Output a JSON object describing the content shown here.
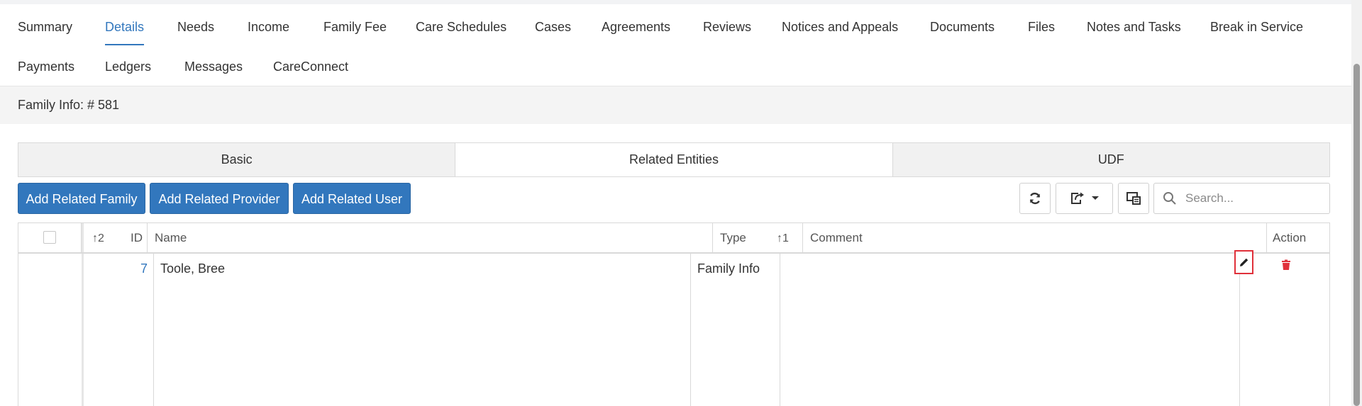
{
  "nav": {
    "row1": [
      "Summary",
      "Details",
      "Needs",
      "Income",
      "Family Fee",
      "Care Schedules",
      "Cases",
      "Agreements",
      "Reviews",
      "Notices and Appeals",
      "Documents",
      "Files",
      "Notes and Tasks",
      "Break in Service"
    ],
    "row2": [
      "Payments",
      "Ledgers",
      "Messages",
      "CareConnect"
    ],
    "active": "Details"
  },
  "header": {
    "title": "Family Info: # 581"
  },
  "subtabs": {
    "basic": "Basic",
    "related": "Related Entities",
    "udf": "UDF",
    "active": "Related Entities"
  },
  "toolbar": {
    "add_family": "Add Related Family",
    "add_provider": "Add Related Provider",
    "add_user": "Add Related User",
    "refresh_icon": "refresh-icon",
    "export_icon": "export-icon",
    "columns_icon": "columns-icon",
    "search_placeholder": "Search..."
  },
  "table": {
    "columns": {
      "sort_id": "2",
      "id": "ID",
      "name": "Name",
      "type": "Type",
      "sort_type": "1",
      "comment": "Comment",
      "action": "Action"
    },
    "rows": [
      {
        "id": "7",
        "name": "Toole, Bree",
        "type": "Family Info",
        "comment": ""
      }
    ]
  },
  "colors": {
    "accent": "#3277bd",
    "delete": "#e0303a",
    "highlight": "#e0303a"
  }
}
